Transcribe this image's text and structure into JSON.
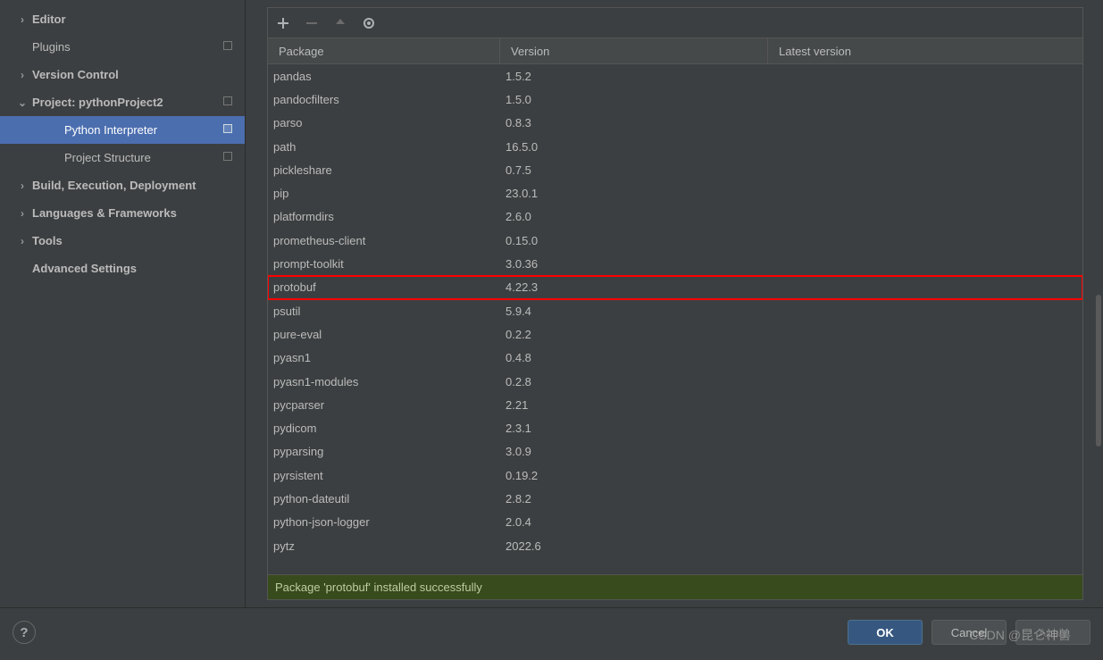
{
  "sidebar": {
    "items": [
      {
        "label": "Editor",
        "indent": 0,
        "arrow": ">",
        "bold": true,
        "pin": false
      },
      {
        "label": "Plugins",
        "indent": 0,
        "arrow": "",
        "bold": false,
        "pin": true
      },
      {
        "label": "Version Control",
        "indent": 0,
        "arrow": ">",
        "bold": true,
        "pin": false
      },
      {
        "label": "Project: pythonProject2",
        "indent": 0,
        "arrow": "v",
        "bold": true,
        "pin": true
      },
      {
        "label": "Python Interpreter",
        "indent": 1,
        "arrow": "",
        "bold": false,
        "pin": true,
        "selected": true
      },
      {
        "label": "Project Structure",
        "indent": 1,
        "arrow": "",
        "bold": false,
        "pin": true
      },
      {
        "label": "Build, Execution, Deployment",
        "indent": 0,
        "arrow": ">",
        "bold": true,
        "pin": false
      },
      {
        "label": "Languages & Frameworks",
        "indent": 0,
        "arrow": ">",
        "bold": true,
        "pin": false
      },
      {
        "label": "Tools",
        "indent": 0,
        "arrow": ">",
        "bold": true,
        "pin": false
      },
      {
        "label": "Advanced Settings",
        "indent": 0,
        "arrow": "",
        "bold": true,
        "pin": false
      }
    ]
  },
  "table": {
    "headers": {
      "package": "Package",
      "version": "Version",
      "latest": "Latest version"
    },
    "rows": [
      {
        "package": "pandas",
        "version": "1.5.2"
      },
      {
        "package": "pandocfilters",
        "version": "1.5.0"
      },
      {
        "package": "parso",
        "version": "0.8.3"
      },
      {
        "package": "path",
        "version": "16.5.0"
      },
      {
        "package": "pickleshare",
        "version": "0.7.5"
      },
      {
        "package": "pip",
        "version": "23.0.1"
      },
      {
        "package": "platformdirs",
        "version": "2.6.0"
      },
      {
        "package": "prometheus-client",
        "version": "0.15.0"
      },
      {
        "package": "prompt-toolkit",
        "version": "3.0.36"
      },
      {
        "package": "protobuf",
        "version": "4.22.3",
        "highlighted": true
      },
      {
        "package": "psutil",
        "version": "5.9.4"
      },
      {
        "package": "pure-eval",
        "version": "0.2.2"
      },
      {
        "package": "pyasn1",
        "version": "0.4.8"
      },
      {
        "package": "pyasn1-modules",
        "version": "0.2.8"
      },
      {
        "package": "pycparser",
        "version": "2.21"
      },
      {
        "package": "pydicom",
        "version": "2.3.1"
      },
      {
        "package": "pyparsing",
        "version": "3.0.9"
      },
      {
        "package": "pyrsistent",
        "version": "0.19.2"
      },
      {
        "package": "python-dateutil",
        "version": "2.8.2"
      },
      {
        "package": "python-json-logger",
        "version": "2.0.4"
      },
      {
        "package": "pytz",
        "version": "2022.6"
      }
    ]
  },
  "status": {
    "message": "Package 'protobuf' installed successfully"
  },
  "footer": {
    "ok": "OK",
    "cancel": "Cancel",
    "apply": "Apply",
    "help": "?"
  },
  "watermark": "CSDN @昆仑神兽"
}
